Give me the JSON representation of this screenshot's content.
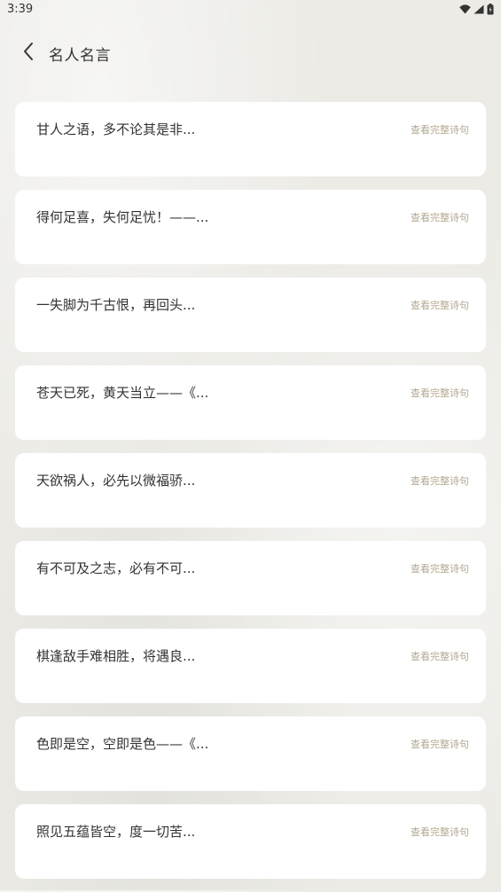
{
  "status_bar": {
    "time": "3:39",
    "icons": [
      "wifi-icon",
      "cellular-signal-icon",
      "battery-icon"
    ]
  },
  "header": {
    "back_icon": "chevron-left-icon",
    "title": "名人名言"
  },
  "quotes": [
    {
      "text": "甘人之语，多不论其是非...",
      "link": "查看完整诗句"
    },
    {
      "text": "得何足喜，失何足忧！——...",
      "link": "查看完整诗句"
    },
    {
      "text": "一失脚为千古恨，再回头...",
      "link": "查看完整诗句"
    },
    {
      "text": "苍天已死，黄天当立——《...",
      "link": "查看完整诗句"
    },
    {
      "text": "天欲祸人，必先以微福骄...",
      "link": "查看完整诗句"
    },
    {
      "text": "有不可及之志，必有不可...",
      "link": "查看完整诗句"
    },
    {
      "text": "棋逢敌手难相胜，将遇良...",
      "link": "查看完整诗句"
    },
    {
      "text": "色即是空，空即是色——《...",
      "link": "查看完整诗句"
    },
    {
      "text": "照见五蕴皆空，度一切苦...",
      "link": "查看完整诗句"
    }
  ],
  "colors": {
    "background": "#ecebe6",
    "card": "#ffffff",
    "link": "#b4a890",
    "text": "#333333"
  }
}
